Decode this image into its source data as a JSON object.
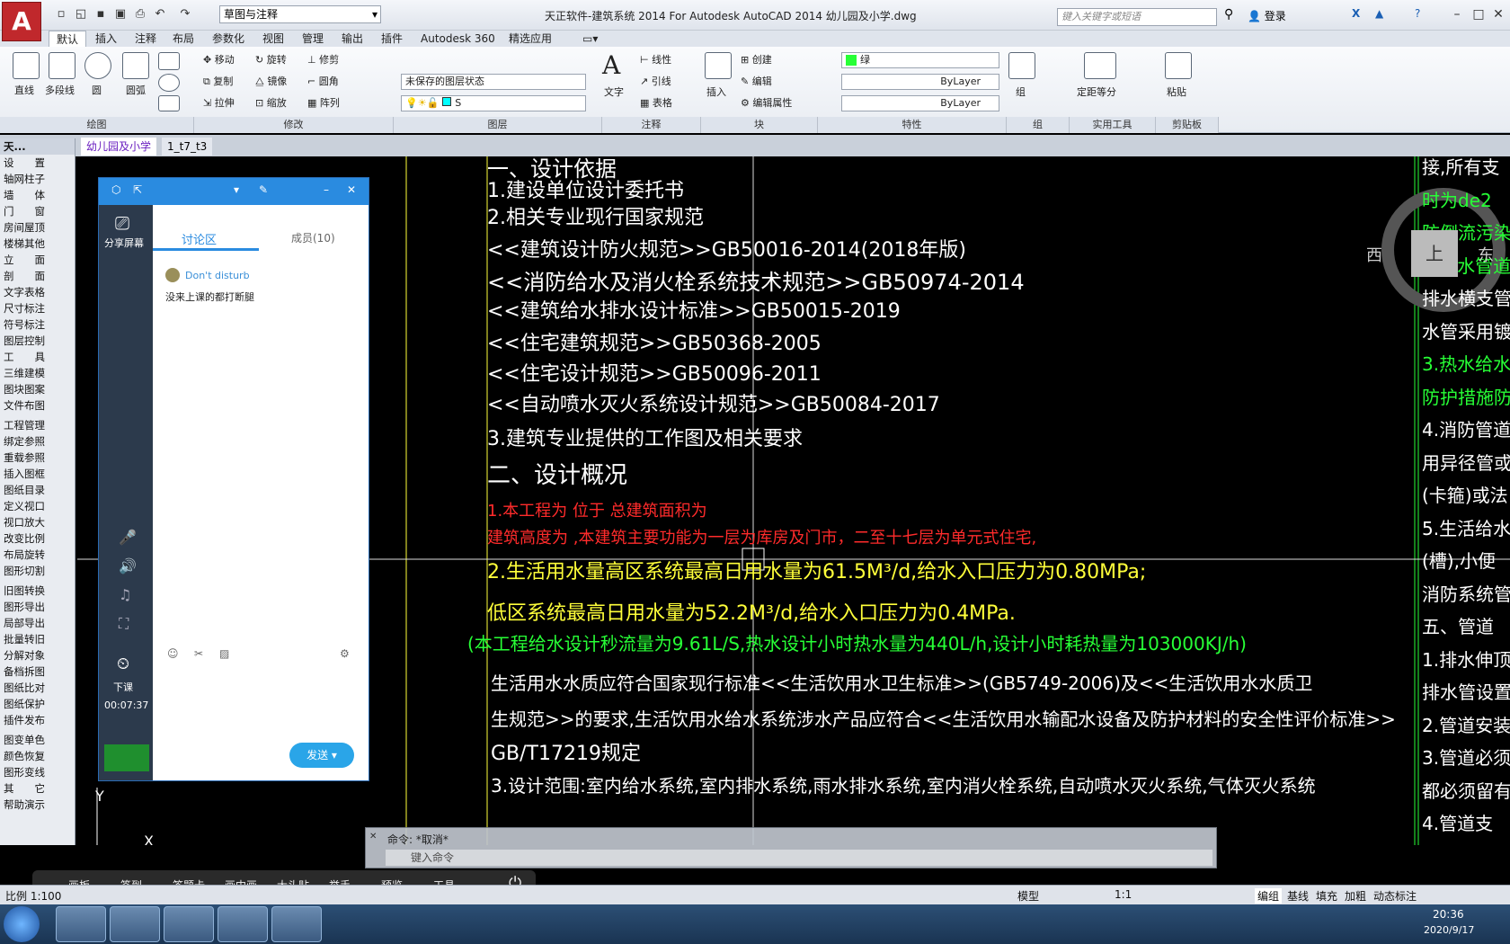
{
  "title_bar": {
    "workspace": "草图与注释",
    "title": "天正软件-建筑系统 2014  For Autodesk AutoCAD 2014    幼儿园及小学.dwg",
    "search_placeholder": "键入关键字或短语",
    "login": "登录"
  },
  "menu_tabs": [
    "默认",
    "插入",
    "注释",
    "布局",
    "参数化",
    "视图",
    "管理",
    "输出",
    "插件",
    "Autodesk 360",
    "精选应用"
  ],
  "ribbon": {
    "draw": {
      "title": "绘图",
      "tools": [
        "直线",
        "多段线",
        "圆",
        "圆弧"
      ]
    },
    "modify": {
      "title": "修改",
      "tools": [
        "移动",
        "旋转",
        "修剪",
        "复制",
        "镜像",
        "圆角",
        "拉伸",
        "缩放",
        "阵列"
      ]
    },
    "layer": {
      "title": "图层",
      "state": "未保存的图层状态",
      "current": "S"
    },
    "annotation": {
      "title": "注释",
      "tools": [
        "文字",
        "线性",
        "引线",
        "表格"
      ]
    },
    "block": {
      "title": "块",
      "tools": [
        "插入",
        "创建",
        "编辑",
        "编辑属性"
      ]
    },
    "properties": {
      "title": "特性",
      "color": "绿",
      "linetype": "ByLayer",
      "lineweight": "ByLayer"
    },
    "groups": {
      "title": "组",
      "tool": "组"
    },
    "utilities": {
      "title": "实用工具",
      "tool": "定距等分"
    },
    "clipboard": {
      "title": "剪贴板",
      "tool": "粘贴"
    }
  },
  "doc_tabs": [
    "幼儿园及小学",
    "1_t7_t3"
  ],
  "left_panel": {
    "header": "天...",
    "items": [
      "设　　置",
      "轴网柱子",
      "墙　　体",
      "门　　窗",
      "房间屋顶",
      "楼梯其他",
      "立　　面",
      "剖　　面",
      "文字表格",
      "尺寸标注",
      "符号标注",
      "图层控制",
      "工　　具",
      "三维建模",
      "图块图案",
      "文件布图",
      "工程管理",
      "绑定参照",
      "重载参照",
      "插入图框",
      "图纸目录",
      "定义视口",
      "视口放大",
      "改变比例",
      "布局旋转",
      "图形切割",
      "旧图转换",
      "图形导出",
      "局部导出",
      "批量转旧",
      "分解对象",
      "备档拆图",
      "图纸比对",
      "图纸保护",
      "插件发布",
      "图变单色",
      "颜色恢复",
      "图形变线",
      "其　　它",
      "帮助演示"
    ]
  },
  "drawing": {
    "lines": [
      {
        "text": "一、设计依据",
        "color": "w"
      },
      {
        "text": "1.建设单位设计委托书",
        "color": "w"
      },
      {
        "text": "2.相关专业现行国家规范",
        "color": "w"
      },
      {
        "text": "<<建筑设计防火规范>>GB50016-2014(2018年版)",
        "color": "w"
      },
      {
        "text": "<<消防给水及消火栓系统技术规范>>GB50974-2014",
        "color": "w"
      },
      {
        "text": "<<建筑给水排水设计标准>>GB50015-2019",
        "color": "w"
      },
      {
        "text": "<<住宅建筑规范>>GB50368-2005",
        "color": "w"
      },
      {
        "text": "<<住宅设计规范>>GB50096-2011",
        "color": "w"
      },
      {
        "text": "<<自动喷水灭火系统设计规范>>GB50084-2017",
        "color": "w"
      },
      {
        "text": "3.建筑专业提供的工作图及相关要求",
        "color": "w"
      },
      {
        "text": "二、设计概况",
        "color": "w"
      },
      {
        "text": "1.本工程为      位于          总建筑面积为",
        "color": "r"
      },
      {
        "text": "建筑高度为      ,本建筑主要功能为一层为库房及门市，二至十七层为单元式住宅,",
        "color": "r"
      },
      {
        "text": "2.生活用水量高区系统最高日用水量为61.5M³/d,给水入口压力为0.80MPa;",
        "color": "y"
      },
      {
        "text": "低区系统最高日用水量为52.2M³/d,给水入口压力为0.4MPa.",
        "color": "y"
      },
      {
        "text": "(本工程给水设计秒流量为9.61L/S,热水设计小时热水量为440L/h,设计小时耗热量为103000KJ/h)",
        "color": "g"
      },
      {
        "text": "生活用水水质应符合国家现行标准<<生活饮用水卫生标准>>(GB5749-2006)及<<生活饮用水水质卫",
        "color": "w"
      },
      {
        "text": "生规范>>的要求,生活饮用水给水系统涉水产品应符合<<生活饮用水输配水设备及防护材料的安全性评价标准>>",
        "color": "w"
      },
      {
        "text": "GB/T17219规定",
        "color": "w"
      },
      {
        "text": "3.设计范围:室内给水系统,室内排水系统,雨水排水系统,室内消火栓系统,自动喷水灭火系统,气体灭火系统",
        "color": "w"
      }
    ],
    "right_lines": [
      {
        "text": "接,所有支",
        "color": "w"
      },
      {
        "text": "时为de2",
        "color": "g"
      },
      {
        "text": "防倒流污染",
        "color": "g"
      },
      {
        "text": "2.排水管道",
        "color": "g"
      },
      {
        "text": "排水横支管",
        "color": "w"
      },
      {
        "text": "水管采用镀",
        "color": "w"
      },
      {
        "text": "3.热水给水",
        "color": "g"
      },
      {
        "text": "防护措施防",
        "color": "g"
      },
      {
        "text": "4.消防管道",
        "color": "w"
      },
      {
        "text": "用异径管或",
        "color": "w"
      },
      {
        "text": "(卡箍)或法",
        "color": "w"
      },
      {
        "text": "5.生活给水",
        "color": "w"
      },
      {
        "text": "(槽),小便",
        "color": "w"
      },
      {
        "text": "消防系统管",
        "color": "w"
      },
      {
        "text": "五、管道",
        "color": "w"
      },
      {
        "text": "1.排水伸顶",
        "color": "w"
      },
      {
        "text": "排水管设置",
        "color": "w"
      },
      {
        "text": "2.管道安装",
        "color": "w"
      },
      {
        "text": "3.管道必须",
        "color": "w"
      },
      {
        "text": "都必须留有",
        "color": "w"
      },
      {
        "text": "4.管道支",
        "color": "w"
      }
    ],
    "viewcube": {
      "west": "西",
      "east": "东",
      "top": "上"
    },
    "ucs": {
      "x": "X",
      "y": "Y"
    }
  },
  "chat_window": {
    "tab_discussion": "讨论区",
    "tab_members": "成员(10)",
    "share_label": "分享屏幕",
    "status": "Don't disturb",
    "message": "没来上课的都打断腿",
    "timer": "00:07:37",
    "end_label": "下课",
    "send": "发送"
  },
  "command": {
    "history": "命令: *取消*",
    "prompt": "键入命令"
  },
  "float_toolbar": [
    "画板",
    "签到",
    "答题卡",
    "画中画",
    "大头贴",
    "举手",
    "预览",
    "工具"
  ],
  "status_bar": {
    "scale": "比例 1:100",
    "model": "模型",
    "items": [
      "编组",
      "基线",
      "填充",
      "加粗",
      "动态标注"
    ],
    "anno_scale": "1:1"
  },
  "taskbar": {
    "time": "20:36",
    "date": "2020/9/17"
  },
  "colors": {
    "white": "#ffffff",
    "red": "#ff2b2b",
    "yellow": "#ffff3a",
    "green": "#27ff36",
    "accent": "#2a8be0"
  }
}
